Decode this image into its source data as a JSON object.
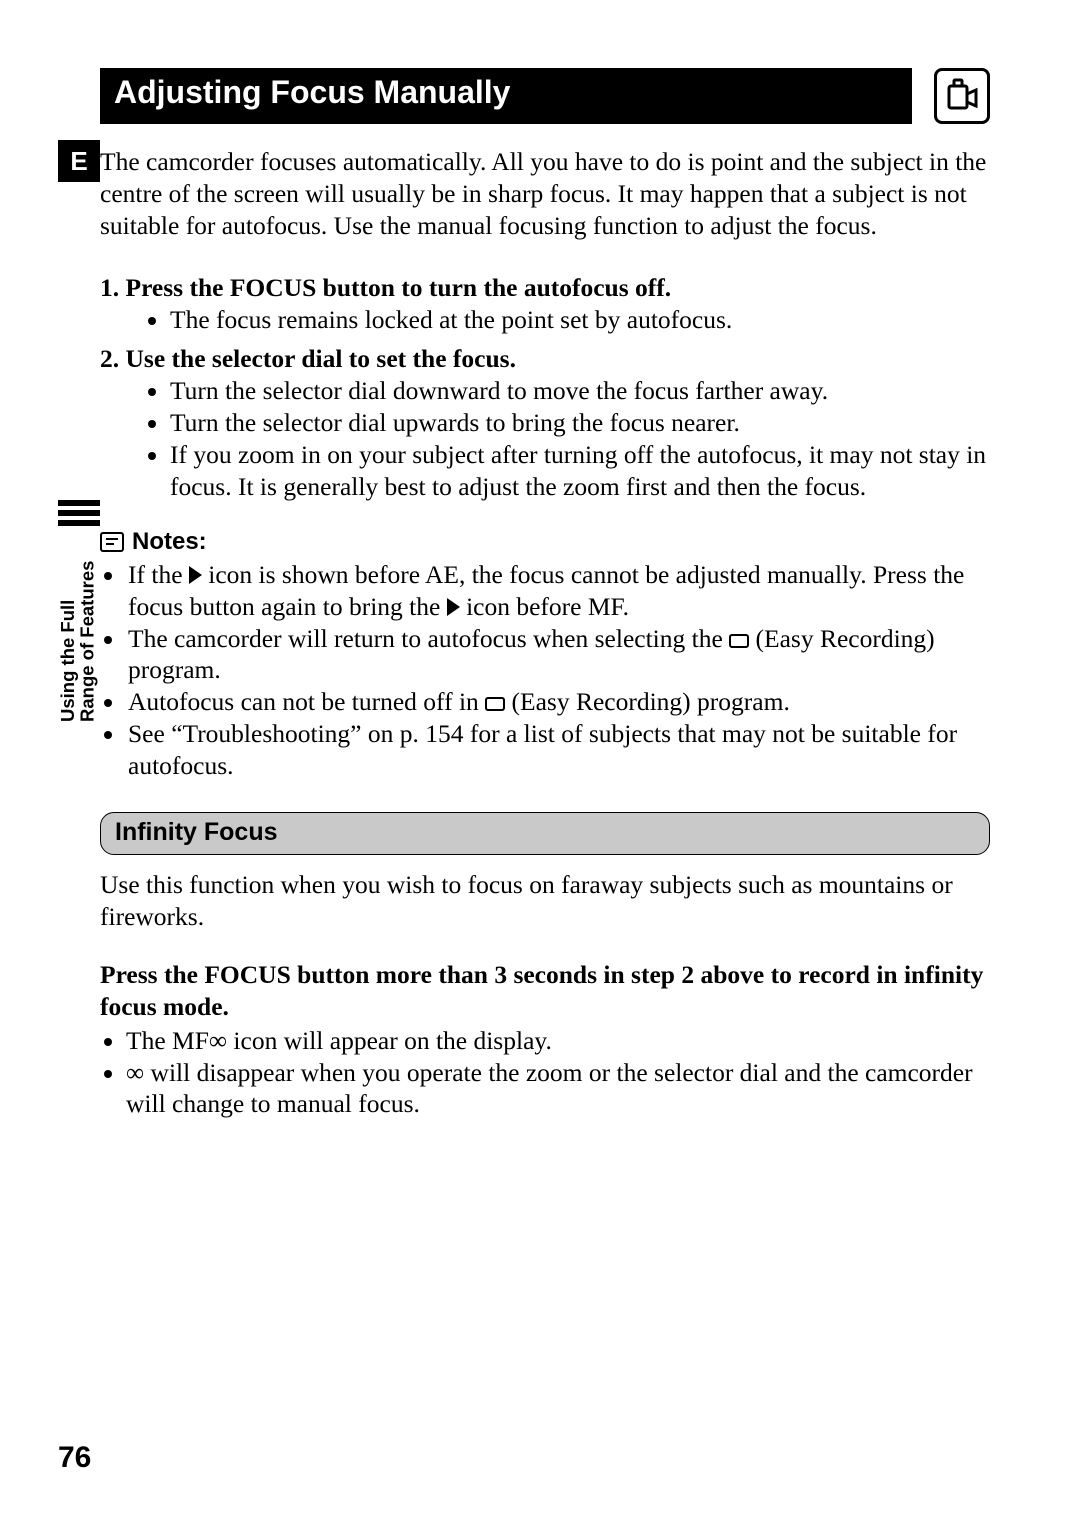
{
  "header": {
    "title": "Adjusting Focus Manually",
    "mode_icon": "camera-mode-icon"
  },
  "badge": "E",
  "side_tab": "Using the Full\nRange of Features",
  "page_number": "76",
  "intro": "The camcorder focuses automatically.  All you have to do is point and the subject in the centre of the screen will usually be in sharp focus.  It may happen that a subject is not suitable for autofocus.  Use the manual focusing function to adjust the focus.",
  "steps": [
    {
      "num": "1.",
      "head": "Press the FOCUS button to turn the autofocus off.",
      "bullets": [
        "The focus remains locked at the point set by autofocus."
      ]
    },
    {
      "num": "2.",
      "head": "Use the selector dial to set the focus.",
      "bullets": [
        "Turn the selector dial downward to move the focus farther away.",
        "Turn the selector dial upwards to bring the focus nearer.",
        "If you zoom in on your subject after turning off the autofocus, it may not stay in focus.  It is generally best to adjust the zoom first and then the focus."
      ]
    }
  ],
  "notes": {
    "label": "Notes:",
    "items": [
      {
        "pre": "If the ",
        "glyph": "triangle",
        "post": " icon is shown before AE, the focus cannot be adjusted manually.  Press the focus button again to bring the ",
        "glyph2": "triangle",
        "post2": " icon before MF."
      },
      {
        "pre": "The camcorder will return to autofocus when selecting the ",
        "glyph": "box",
        "post": " (Easy Recording) program."
      },
      {
        "pre": "Autofocus can not be turned off in ",
        "glyph": "box",
        "post": " (Easy Recording) program."
      },
      {
        "pre": "See “Troubleshooting” on p. 154 for a list of subjects that may not be suitable for autofocus.",
        "glyph": "",
        "post": ""
      }
    ]
  },
  "subsection": {
    "title": "Infinity Focus",
    "intro": "Use this function when you wish to focus on faraway subjects such as mountains or fireworks.",
    "step": "Press the FOCUS button more than 3 seconds in step 2 above to record in infinity focus mode.",
    "bullets": [
      "The MF∞ icon will appear on the display.",
      "∞ will disappear when you operate the zoom or the selector dial and the camcorder will change to manual focus."
    ]
  }
}
